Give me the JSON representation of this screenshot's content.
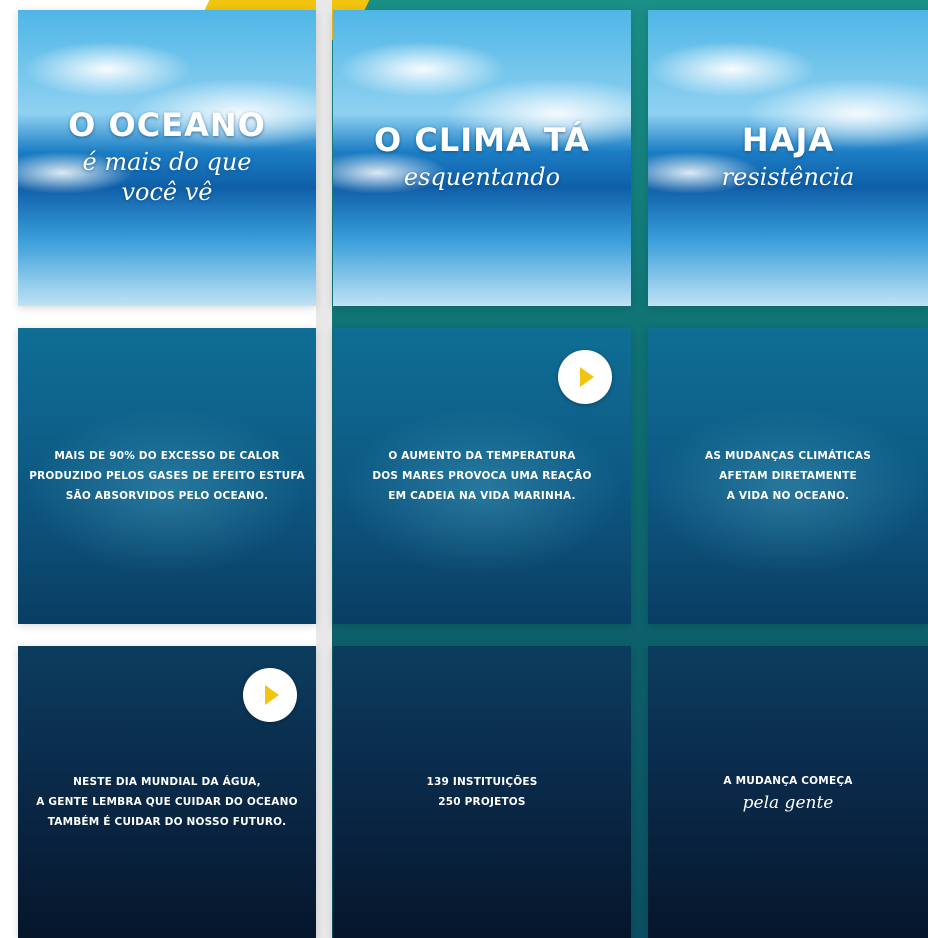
{
  "tiles": [
    {
      "title": "O OCEANO",
      "script": "é mais do que\nvocê vê"
    },
    {
      "title": "O CLIMA TÁ",
      "script": "esquentando"
    },
    {
      "title": "HAJA",
      "script": "resistência"
    },
    {
      "caption": "MAIS DE 90% DO EXCESSO DE CALOR\nPRODUZIDO PELOS GASES DE EFEITO ESTUFA\nSÃO ABSORVIDOS PELO OCEANO."
    },
    {
      "caption": "O AUMENTO DA TEMPERATURA\nDOS MARES PROVOCA UMA REAÇÃO\nEM CADEIA NA VIDA MARINHA.",
      "icon": "play-icon"
    },
    {
      "caption": "AS MUDANÇAS CLIMÁTICAS\nAFETAM DIRETAMENTE\nA VIDA NO OCEANO."
    },
    {
      "caption": "NESTE DIA MUNDIAL DA ÁGUA,\nA GENTE LEMBRA QUE CUIDAR DO OCEANO\nTAMBÉM É CUIDAR DO NOSSO FUTURO.",
      "icon": "play-icon"
    },
    {
      "caption": "139 INSTITUIÇÕES\n250 PROJETOS"
    },
    {
      "caption": "A MUDANÇA COMEÇA",
      "script": "pela gente"
    }
  ],
  "colors": {
    "accent_yellow": "#f1c40f",
    "ocean_green": "#1a8f86",
    "deep_navy": "#06162b"
  }
}
